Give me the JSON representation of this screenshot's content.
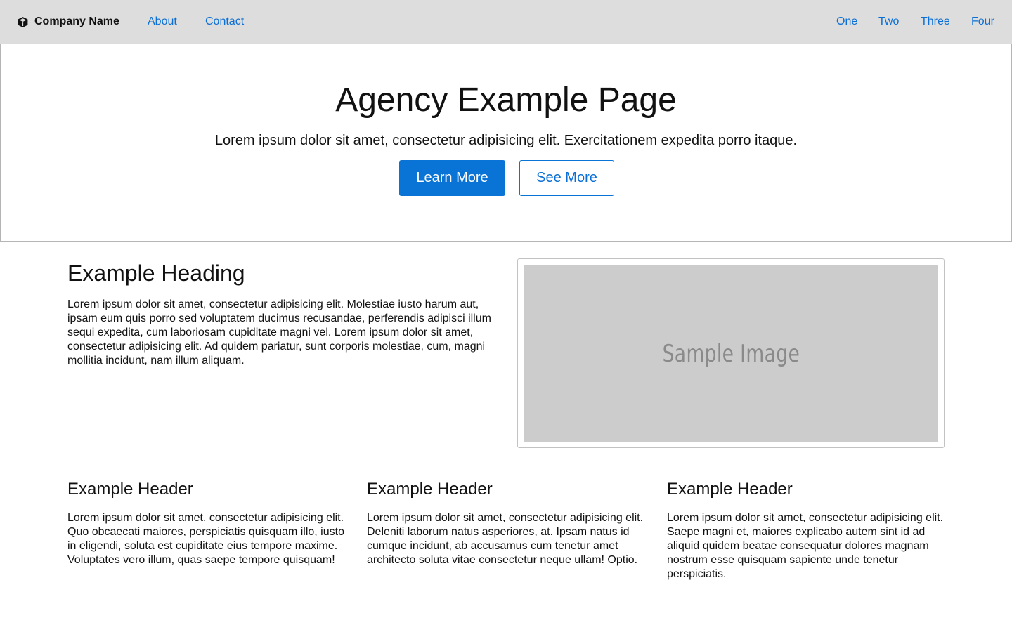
{
  "navbar": {
    "brand": "Company Name",
    "brand_icon": "cube-icon",
    "left_links": [
      "About",
      "Contact"
    ],
    "right_links": [
      "One",
      "Two",
      "Three",
      "Four"
    ],
    "link_color": "#0a6fd6",
    "background": "#dddddd"
  },
  "hero": {
    "title": "Agency Example Page",
    "subtitle": "Lorem ipsum dolor sit amet, consectetur adipisicing elit. Exercitationem expedita porro itaque.",
    "primary_button": "Learn More",
    "secondary_button": "See More",
    "accent": "#0a73d6"
  },
  "feature": {
    "heading": "Example Heading",
    "text": "Lorem ipsum dolor sit amet, consectetur adipisicing elit. Molestiae iusto harum aut, ipsam eum quis porro sed voluptatem ducimus recusandae, perferendis adipisci illum sequi expedita, cum laboriosam cupiditate magni vel. Lorem ipsum dolor sit amet, consectetur adipisicing elit. Ad quidem pariatur, sunt corporis molestiae, cum, magni mollitia incidunt, nam illum aliquam.",
    "image_label": "Sample Image"
  },
  "columns": [
    {
      "title": "Example Header",
      "text": "Lorem ipsum dolor sit amet, consectetur adipisicing elit. Quo obcaecati maiores, perspiciatis quisquam illo, iusto in eligendi, soluta est cupiditate eius tempore maxime. Voluptates vero illum, quas saepe tempore quisquam!"
    },
    {
      "title": "Example Header",
      "text": "Lorem ipsum dolor sit amet, consectetur adipisicing elit. Deleniti laborum natus asperiores, at. Ipsam natus id cumque incidunt, ab accusamus cum tenetur amet architecto soluta vitae consectetur neque ullam! Optio."
    },
    {
      "title": "Example Header",
      "text": "Lorem ipsum dolor sit amet, consectetur adipisicing elit. Saepe magni et, maiores explicabo autem sint id ad aliquid quidem beatae consequatur dolores magnam nostrum esse quisquam sapiente unde tenetur perspiciatis."
    }
  ]
}
